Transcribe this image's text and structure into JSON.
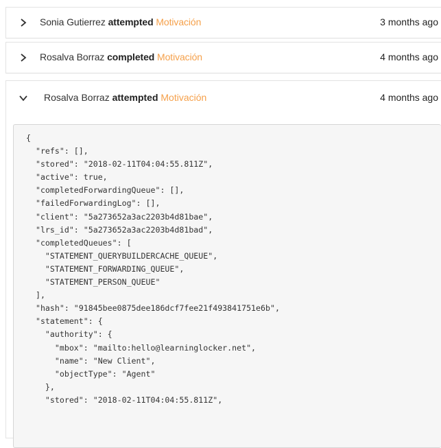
{
  "statements": [
    {
      "actor": "Sonia Gutierrez",
      "verb": "attempted",
      "activity": "Motivación",
      "time": "3 months ago",
      "expanded": false
    },
    {
      "actor": "Rosalva Borraz",
      "verb": "completed",
      "activity": "Motivación",
      "time": "4 months ago",
      "expanded": false
    },
    {
      "actor": "Rosalva Borraz",
      "verb": "attempted",
      "activity": "Motivación",
      "time": "4 months ago",
      "expanded": true
    }
  ],
  "json_lines": [
    "{",
    "  \"refs\": [],",
    "  \"stored\": \"2018-02-11T04:04:55.811Z\",",
    "  \"active\": true,",
    "  \"completedForwardingQueue\": [],",
    "  \"failedForwardingLog\": [],",
    "  \"client\": \"5a273652a3ac2203b4d81bae\",",
    "  \"lrs_id\": \"5a273652a3ac2203b4d81bad\",",
    "  \"completedQueues\": [",
    "    \"STATEMENT_QUERYBUILDERCACHE_QUEUE\",",
    "    \"STATEMENT_FORWARDING_QUEUE\",",
    "    \"STATEMENT_PERSON_QUEUE\"",
    "  ],",
    "  \"hash\": \"91845bee0875dee186dcf7fee21f493841751e6b\",",
    "  \"statement\": {",
    "    \"authority\": {",
    "      \"mbox\": \"mailto:hello@learninglocker.net\",",
    "      \"name\": \"New Client\",",
    "      \"objectType\": \"Agent\"",
    "    },",
    "    \"stored\": \"2018-02-11T04:04:55.811Z\","
  ],
  "colors": {
    "activity": "#f5a04a",
    "border": "#e3e3e3",
    "json_bg": "#f6f6f6"
  },
  "icons": {
    "collapsed": "chevron-right-icon",
    "expanded": "chevron-down-icon"
  }
}
